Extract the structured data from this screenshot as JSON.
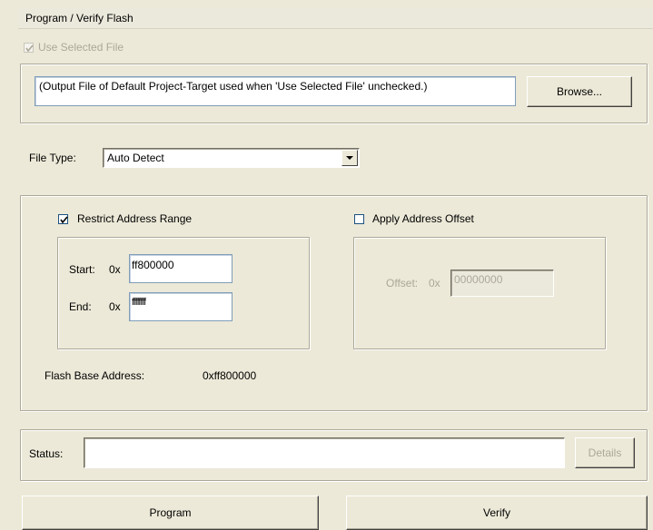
{
  "header": {
    "title": "Program / Verify Flash"
  },
  "file_section": {
    "use_selected_label": "Use Selected File",
    "use_selected_checked": true,
    "file_path": "(Output File of Default Project-Target used when 'Use Selected File' unchecked.)",
    "browse_label": "Browse..."
  },
  "file_type": {
    "label": "File Type:",
    "value": "Auto Detect"
  },
  "address": {
    "restrict_label": "Restrict Address Range",
    "restrict_checked": true,
    "start_label": "Start:",
    "start_prefix": "0x",
    "start_value": "ff800000",
    "end_label": "End:",
    "end_prefix": "0x",
    "end_value": "ffffffff",
    "offset_toggle_label": "Apply Address Offset",
    "offset_checked": false,
    "offset_label": "Offset:",
    "offset_prefix": "0x",
    "offset_value": "00000000",
    "base_label": "Flash Base Address:",
    "base_value": "0xff800000"
  },
  "status": {
    "label": "Status:",
    "value": "",
    "details_label": "Details"
  },
  "actions": {
    "program_label": "Program",
    "verify_label": "Verify"
  }
}
